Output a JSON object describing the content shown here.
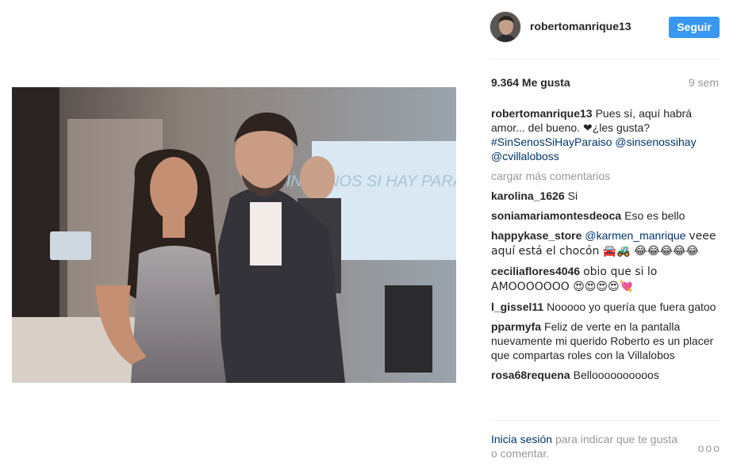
{
  "header": {
    "username": "robertomanrique13",
    "follow_label": "Seguir"
  },
  "stats": {
    "likes": "9.364 Me gusta",
    "age": "9 sem"
  },
  "photo": {
    "background_text": "SIN SENOS SI HAY PARAISO"
  },
  "caption": {
    "user": "robertomanrique13",
    "text": "Pues sí, aquí habrá amor... del bueno. ❤¿les gusta?",
    "hashtag": "#SinSenosSiHayParaiso",
    "mention1": "@sinsenossihay",
    "mention2": "@cvillaloboss"
  },
  "load_more": "cargar más comentarios",
  "comments": [
    {
      "user": "karolina_1626",
      "text": "Si"
    },
    {
      "user": "soniamariamontesdeoca",
      "text": "Eso es bello"
    },
    {
      "user": "happykase_store",
      "mention": "@karmen_manrique",
      "text": "veee aquí está el chocón 🚘🚜 😂😂😂😂😂"
    },
    {
      "user": "ceciliaflores4046",
      "text": "obio que si lo AMOOOOOOO 😍😍😍😍💘"
    },
    {
      "user": "l_gissel11",
      "text": "Nooooo yo quería que fuera gatoo"
    },
    {
      "user": "pparmyfa",
      "text": "Feliz de verte en la pantalla nuevamente mi querido Roberto es un placer que compartas roles con la Villalobos"
    },
    {
      "user": "rosa68requena",
      "text": "Belloooooooooos"
    }
  ],
  "footer": {
    "login_label": "Inicia sesión",
    "rest": "para indicar que te gusta o comentar.",
    "more_label": "ooo"
  },
  "colors": {
    "accent": "#3897f0",
    "link": "#003569",
    "muted": "#999999"
  }
}
